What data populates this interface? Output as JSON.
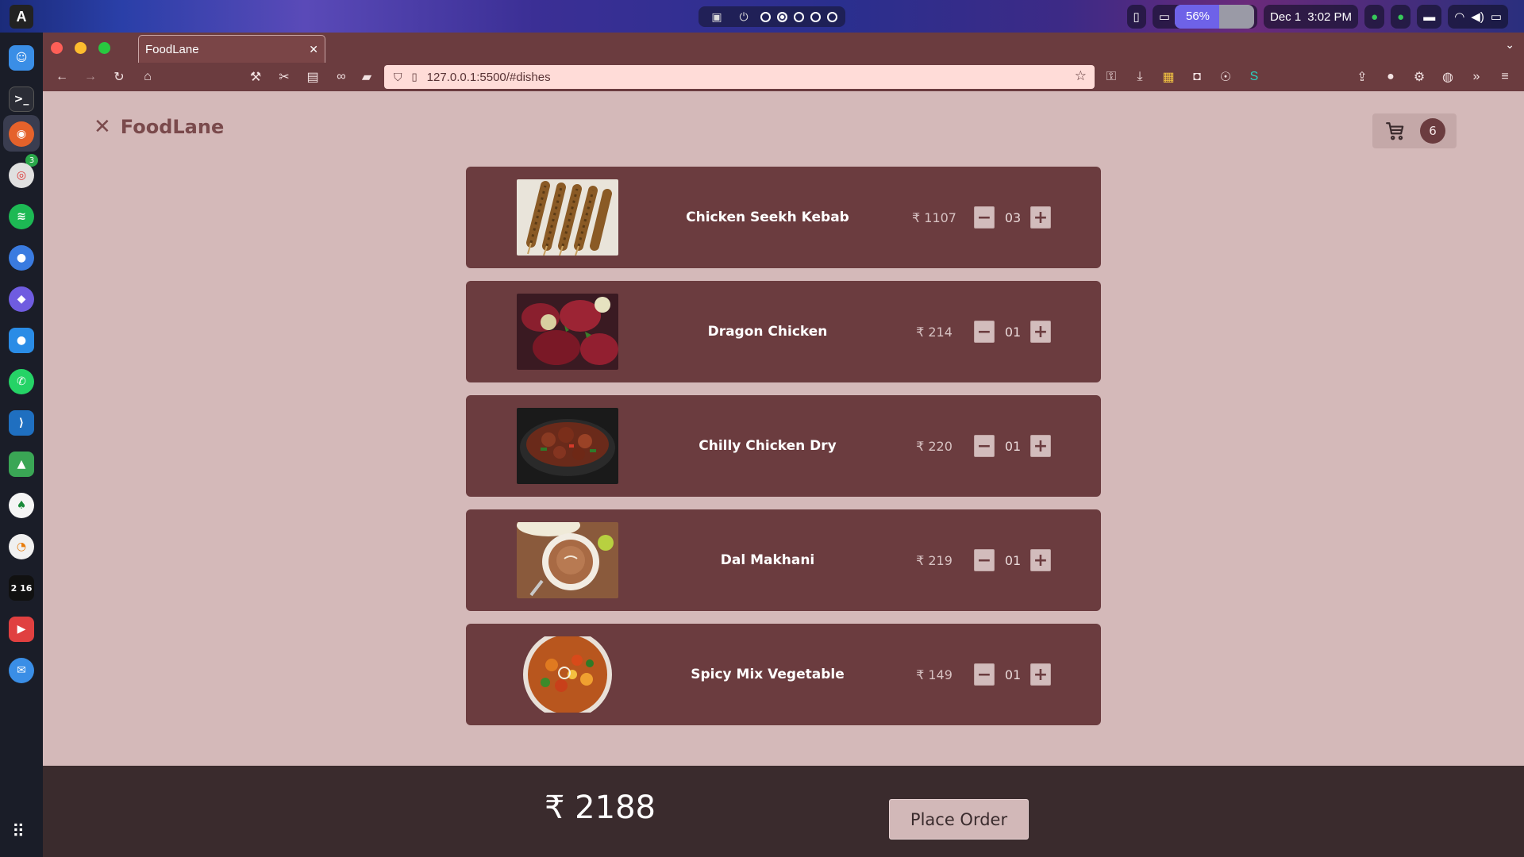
{
  "system": {
    "battery_percent": "56%",
    "date": "Dec 1",
    "time": "3:02 PM"
  },
  "dock": {
    "firefox_badge": "3",
    "clock_label": "2 16"
  },
  "browser": {
    "tab_title": "FoodLane",
    "url": "127.0.0.1:5500/#dishes"
  },
  "page": {
    "logo_text": "FoodLane",
    "cart_count": "6",
    "total": "₹ 2188",
    "place_order_label": "Place Order"
  },
  "dishes": [
    {
      "name": "Chicken Seekh Kebab",
      "price": "₹ 1107",
      "qty": "03"
    },
    {
      "name": "Dragon Chicken",
      "price": "₹ 214",
      "qty": "01"
    },
    {
      "name": "Chilly Chicken Dry",
      "price": "₹ 220",
      "qty": "01"
    },
    {
      "name": "Dal Makhani",
      "price": "₹ 219",
      "qty": "01"
    },
    {
      "name": "Spicy Mix Vegetable",
      "price": "₹ 149",
      "qty": "01"
    }
  ],
  "colors": {
    "brand": "#6b3c3f",
    "page_bg": "#d4b9b9",
    "footer_bg": "#3a2b2d"
  }
}
